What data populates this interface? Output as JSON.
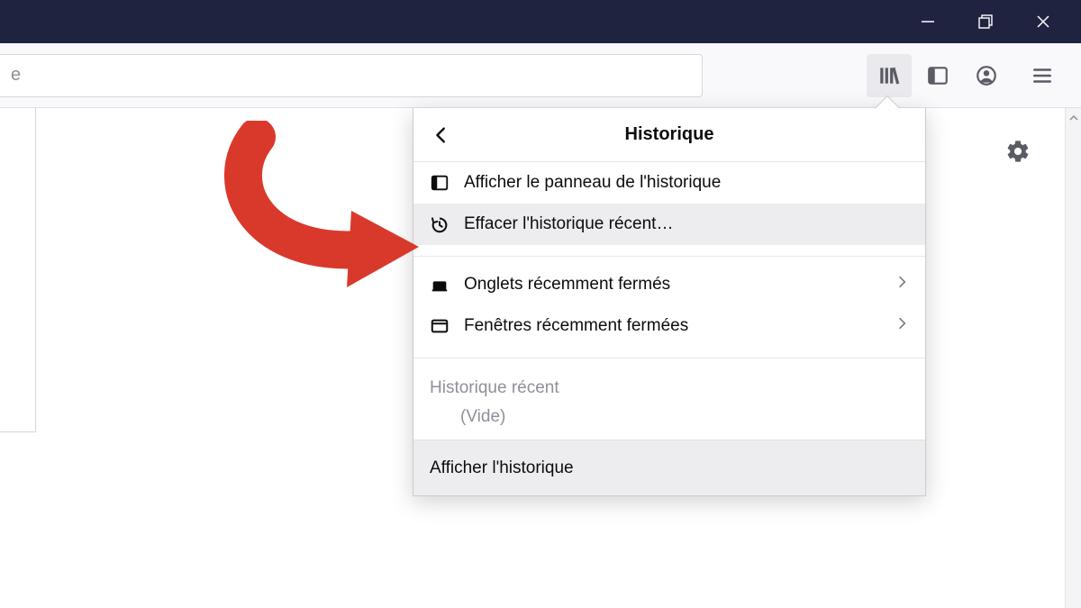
{
  "urlbar_placeholder_partial": "e",
  "panel": {
    "title": "Historique",
    "items": {
      "show_sidebar": "Afficher le panneau de l'historique",
      "clear_recent": "Effacer l'historique récent…",
      "recent_tabs": "Onglets récemment fermés",
      "recent_windows": "Fenêtres récemment fermées"
    },
    "section_label": "Historique récent",
    "empty": "(Vide)",
    "show_all": "Afficher l'historique"
  }
}
